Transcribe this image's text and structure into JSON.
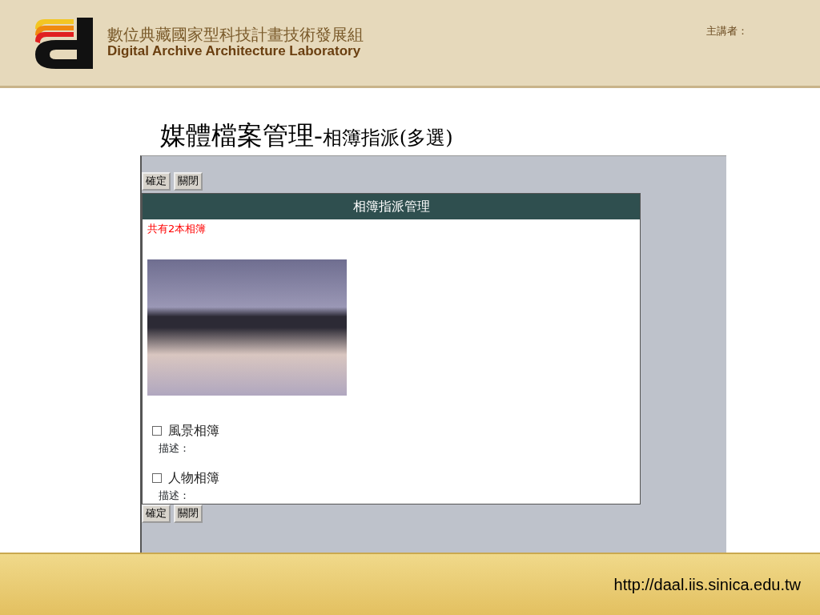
{
  "header": {
    "org_name_zh": "數位典藏國家型科技計畫技術發展組",
    "org_name_en": "Digital Archive Architecture Laboratory",
    "speaker_label": "主講者："
  },
  "slide_title": {
    "main": "媒體檔案管理-",
    "sub": "相簿指派(多選)"
  },
  "screenshot": {
    "top_buttons": [
      "確定",
      "關閉"
    ],
    "panel_title": "相簿指派管理",
    "album_count": "共有2本相簿",
    "albums": [
      {
        "name": "風景相簿",
        "description_label": "描述：",
        "checked": false
      },
      {
        "name": "人物相簿",
        "description_label": "描述：",
        "checked": false
      }
    ],
    "bottom_buttons": [
      "確定",
      "關閉"
    ]
  },
  "footer": {
    "url": "http://daal.iis.sinica.edu.tw"
  }
}
